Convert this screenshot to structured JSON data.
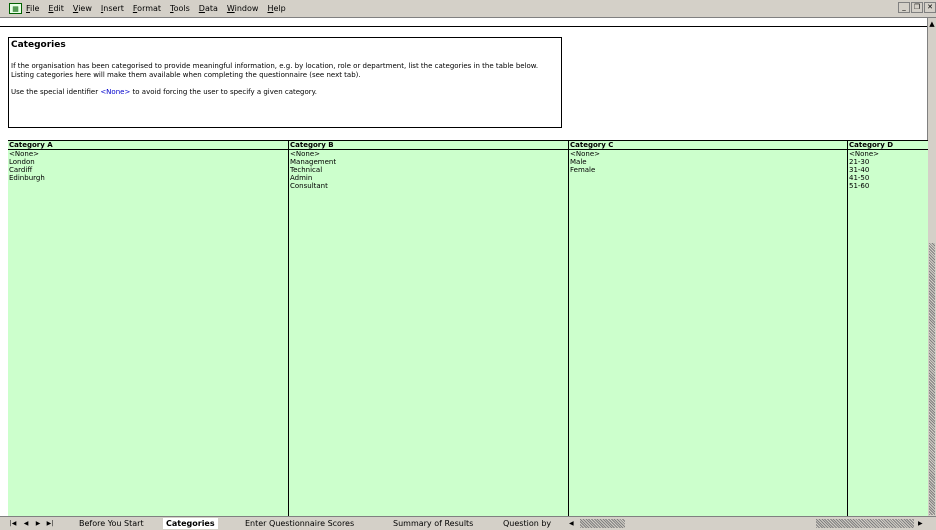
{
  "menubar": {
    "items": [
      "File",
      "Edit",
      "View",
      "Insert",
      "Format",
      "Tools",
      "Data",
      "Window",
      "Help"
    ]
  },
  "info": {
    "title": "Categories",
    "paragraph1": "If the organisation has been categorised to provide meaningful information, e.g. by location, role or department, list the categories in the table below. Listing categories here will make them available when completing the questionnaire (see next tab).",
    "paragraph2_before": "Use the special identifier ",
    "paragraph2_special": "<None>",
    "paragraph2_after": " to avoid forcing the user to specify a given category."
  },
  "columns": [
    {
      "header": "Category A",
      "items": [
        "<None>",
        "London",
        "Cardiff",
        "Edinburgh"
      ]
    },
    {
      "header": "Category B",
      "items": [
        "<None>",
        "Management",
        "Technical",
        "Admin",
        "Consultant"
      ]
    },
    {
      "header": "Category C",
      "items": [
        "<None>",
        "Male",
        "Female"
      ]
    },
    {
      "header": "Category D",
      "items": [
        "<None>",
        "21-30",
        "31-40",
        "41-50",
        "51-60"
      ]
    }
  ],
  "tabs": [
    "Before You Start",
    "Categories",
    "Enter Questionnaire Scores",
    "Summary of Results",
    "Question by"
  ],
  "active_tab": "Categories",
  "colors": {
    "grid_bg": "#ccffcc",
    "chrome": "#d4d0c8",
    "special": "#0000cc"
  }
}
